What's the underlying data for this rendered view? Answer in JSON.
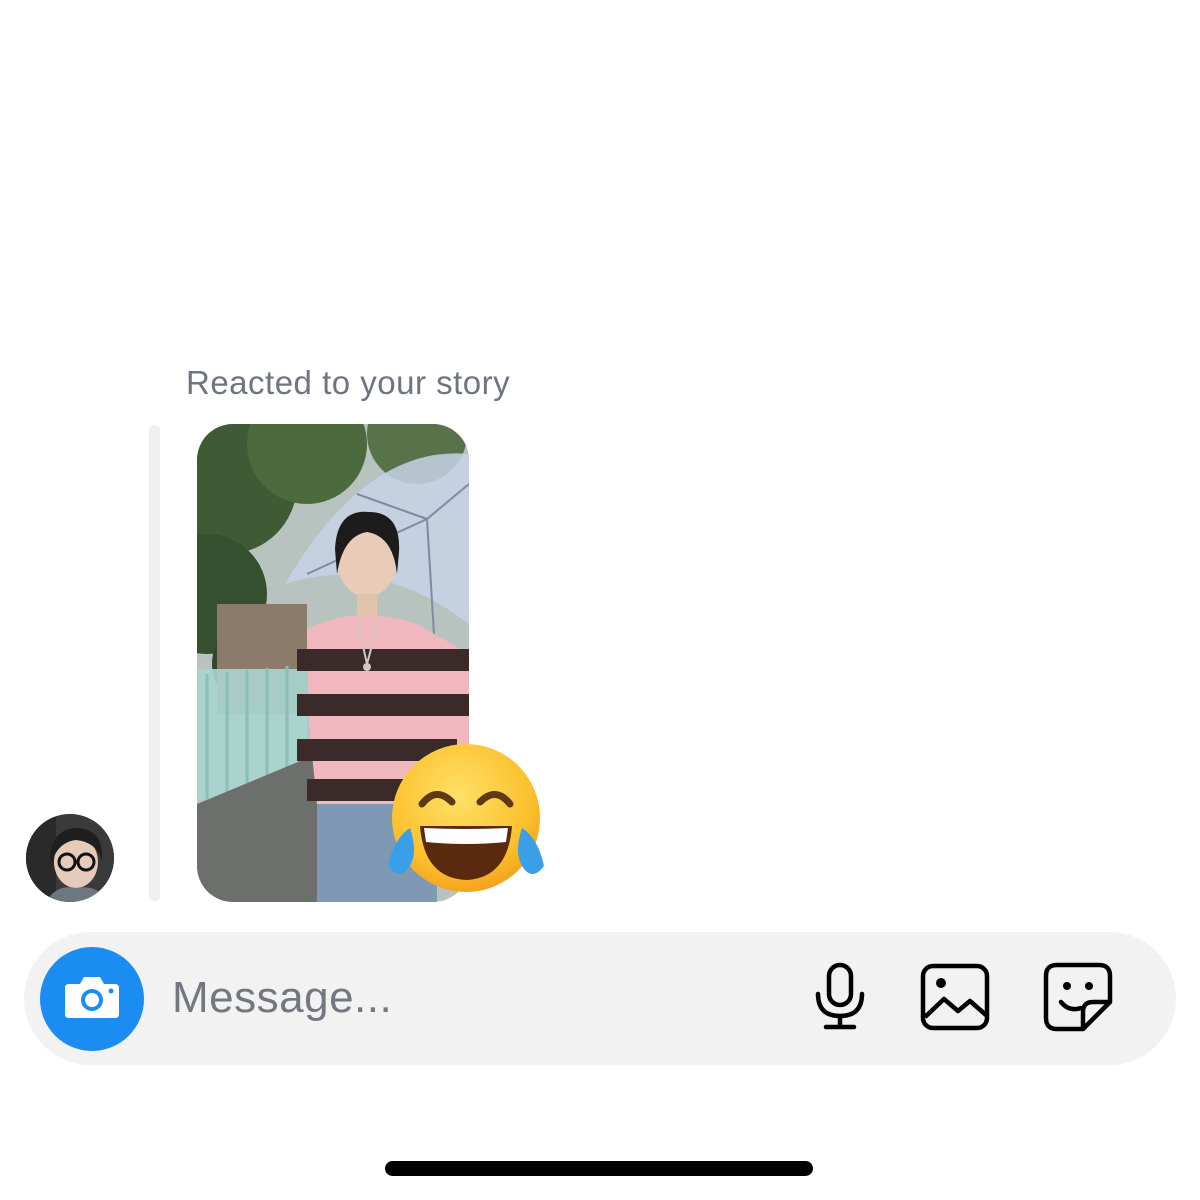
{
  "conversation": {
    "reaction_caption": "Reacted to your story",
    "story_reaction_emoji": "face-with-tears-of-joy-icon"
  },
  "composer": {
    "placeholder": "Message...",
    "camera_icon": "camera-icon",
    "mic_icon": "microphone-icon",
    "gallery_icon": "image-gallery-icon",
    "sticker_icon": "sticker-icon"
  },
  "colors": {
    "accent": "#1b8cf2",
    "caption": "#6e7580",
    "composer_bg": "#f2f2f2"
  }
}
